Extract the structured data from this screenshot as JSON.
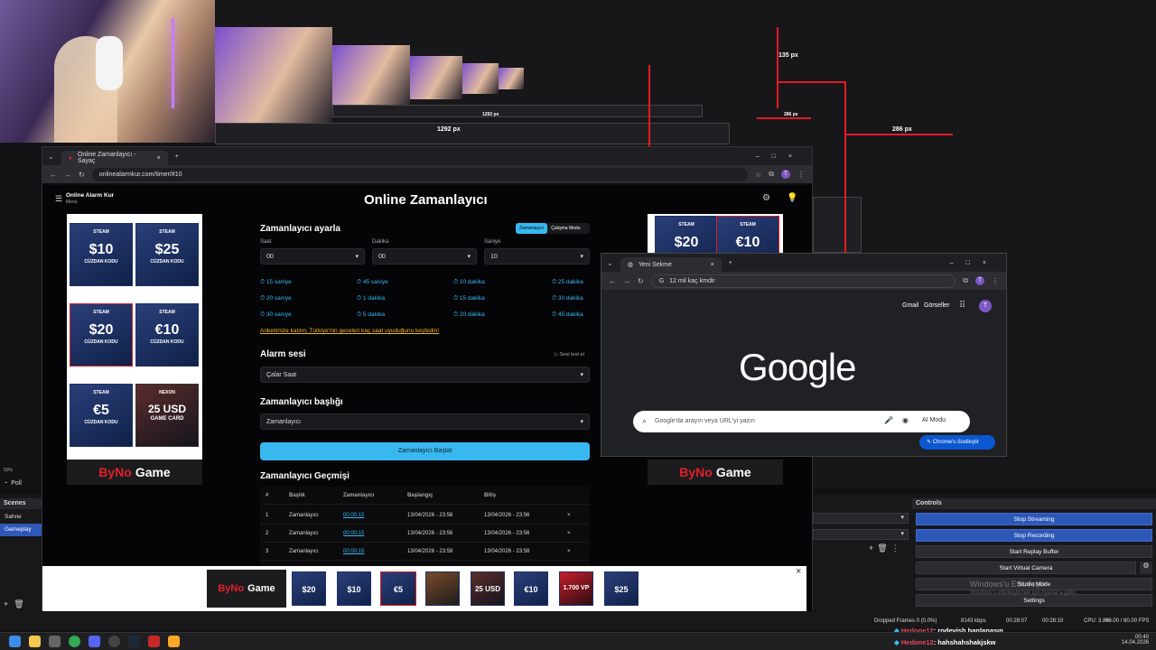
{
  "stream_preview": {
    "px_labels": [
      "135 px",
      "1292 px",
      "286 px",
      "286 px",
      "1292 px"
    ]
  },
  "win1": {
    "tab_title": "Online Zamanlayıcı - Sayaç",
    "url": "onlinealarmkur.com/timer/#10",
    "profile": "T"
  },
  "site": {
    "brand": "Online Alarm Kur",
    "menu": "Menü",
    "title": "Online Zamanlayıcı",
    "section_set": "Zamanlayıcı ayarla",
    "mode_timer": "Zamanlayıcı",
    "mode_work": "Çalışma Modu",
    "label_hour": "Saat",
    "label_min": "Dakika",
    "label_sec": "Saniye",
    "val_hour": "00",
    "val_min": "00",
    "val_sec": "10",
    "presets": [
      "15 saniye",
      "45 saniye",
      "10 dakika",
      "25 dakika",
      "20 saniye",
      "1 dakika",
      "15 dakika",
      "30 dakika",
      "30 saniye",
      "5 dakika",
      "20 dakika",
      "45 dakika"
    ],
    "survey_link": "Anketimize katılın, Türkiye'nin geceleri kaç saat uyuduğunu keşfedin!",
    "alarm_title": "Alarm sesi",
    "alarm_test": "Sesi test et",
    "alarm_value": "Çalar Saat",
    "timer_title_label": "Zamanlayıcı başlığı",
    "timer_title_value": "Zamanlayıcı",
    "start_button": "Zamanlayıcı Başlat",
    "history_title": "Zamanlayıcı Geçmişi",
    "history_headers": [
      "#",
      "Başlık",
      "Zamanlayıcı",
      "Başlangıç",
      "Bitiş"
    ],
    "history_rows": [
      {
        "n": "1",
        "title": "Zamanlayıcı",
        "dur": "00:00:15",
        "start": "13/04/2026 - 23:56",
        "end": "13/04/2026 - 23:56",
        "del": "×"
      },
      {
        "n": "2",
        "title": "Zamanlayıcı",
        "dur": "00:00:15",
        "start": "13/04/2026 - 23:56",
        "end": "13/04/2026 - 23:56",
        "del": "×"
      },
      {
        "n": "3",
        "title": "Zamanlayıcı",
        "dur": "00:00:15",
        "start": "13/04/2026 - 23:58",
        "end": "13/04/2026 - 23:58",
        "del": "×"
      }
    ]
  },
  "ads": {
    "brand_a": "ByNo",
    "brand_b": "Game",
    "steam": "STEAM",
    "wallet": "CÜZDAN KODU",
    "cards_left": [
      "$10",
      "$25",
      "$20",
      "€10",
      "€5"
    ],
    "nexon_top": "NEXON",
    "nexon_amt": "25 USD",
    "nexon_sub": "GAME CARD",
    "bottom_cards": [
      "$20",
      "$10",
      "€5",
      "25 USD",
      "€10",
      "1.700 VP",
      "$25"
    ],
    "close": "×"
  },
  "win2": {
    "tab_title": "Yeni Sekme",
    "url": "12 mil kaç kmdir",
    "gmail": "Gmail",
    "images": "Görseller",
    "logo": "Google",
    "search_placeholder": "Google'da arayın veya URL'yi yazın",
    "ai_mode": "AI Modu",
    "customize": "Chrome'u özelleştir",
    "profile": "T"
  },
  "obs": {
    "zoom": "50%",
    "poll": "Poll",
    "scenes_header": "Scenes",
    "scenes": [
      "Sahne",
      "Gameplay"
    ],
    "controls_header": "Controls",
    "controls": [
      "Stop Streaming",
      "Stop Recording",
      "Start Replay Buffer",
      "Start Virtual Camera",
      "Studio Mode",
      "Settings"
    ],
    "windows_activate_1": "Windows'u Etkinleştir",
    "windows_activate_2": "Windows'u etkinleştirmek için Ayarlar'a gidin.",
    "status_dropped": "Dropped Frames 0 (0.0%)",
    "status_kbps": "8143 kbps",
    "status_stream": "00:28:07",
    "status_rec": "00:28:10",
    "status_cpu": "CPU: 3.8%",
    "status_fps": "60.00 / 60.00 FPS"
  },
  "chat": [
    {
      "user": "Hedone12",
      "msg": ": rodevish banlanasın"
    },
    {
      "user": "Hedone12",
      "msg": ": hahshahshakjskw"
    }
  ],
  "clock": {
    "time": "00:40",
    "date": "14.04.2026"
  },
  "colors": {
    "accent": "#39b8f0",
    "red": "#e01b24",
    "obs_blue": "#2d58b8"
  }
}
